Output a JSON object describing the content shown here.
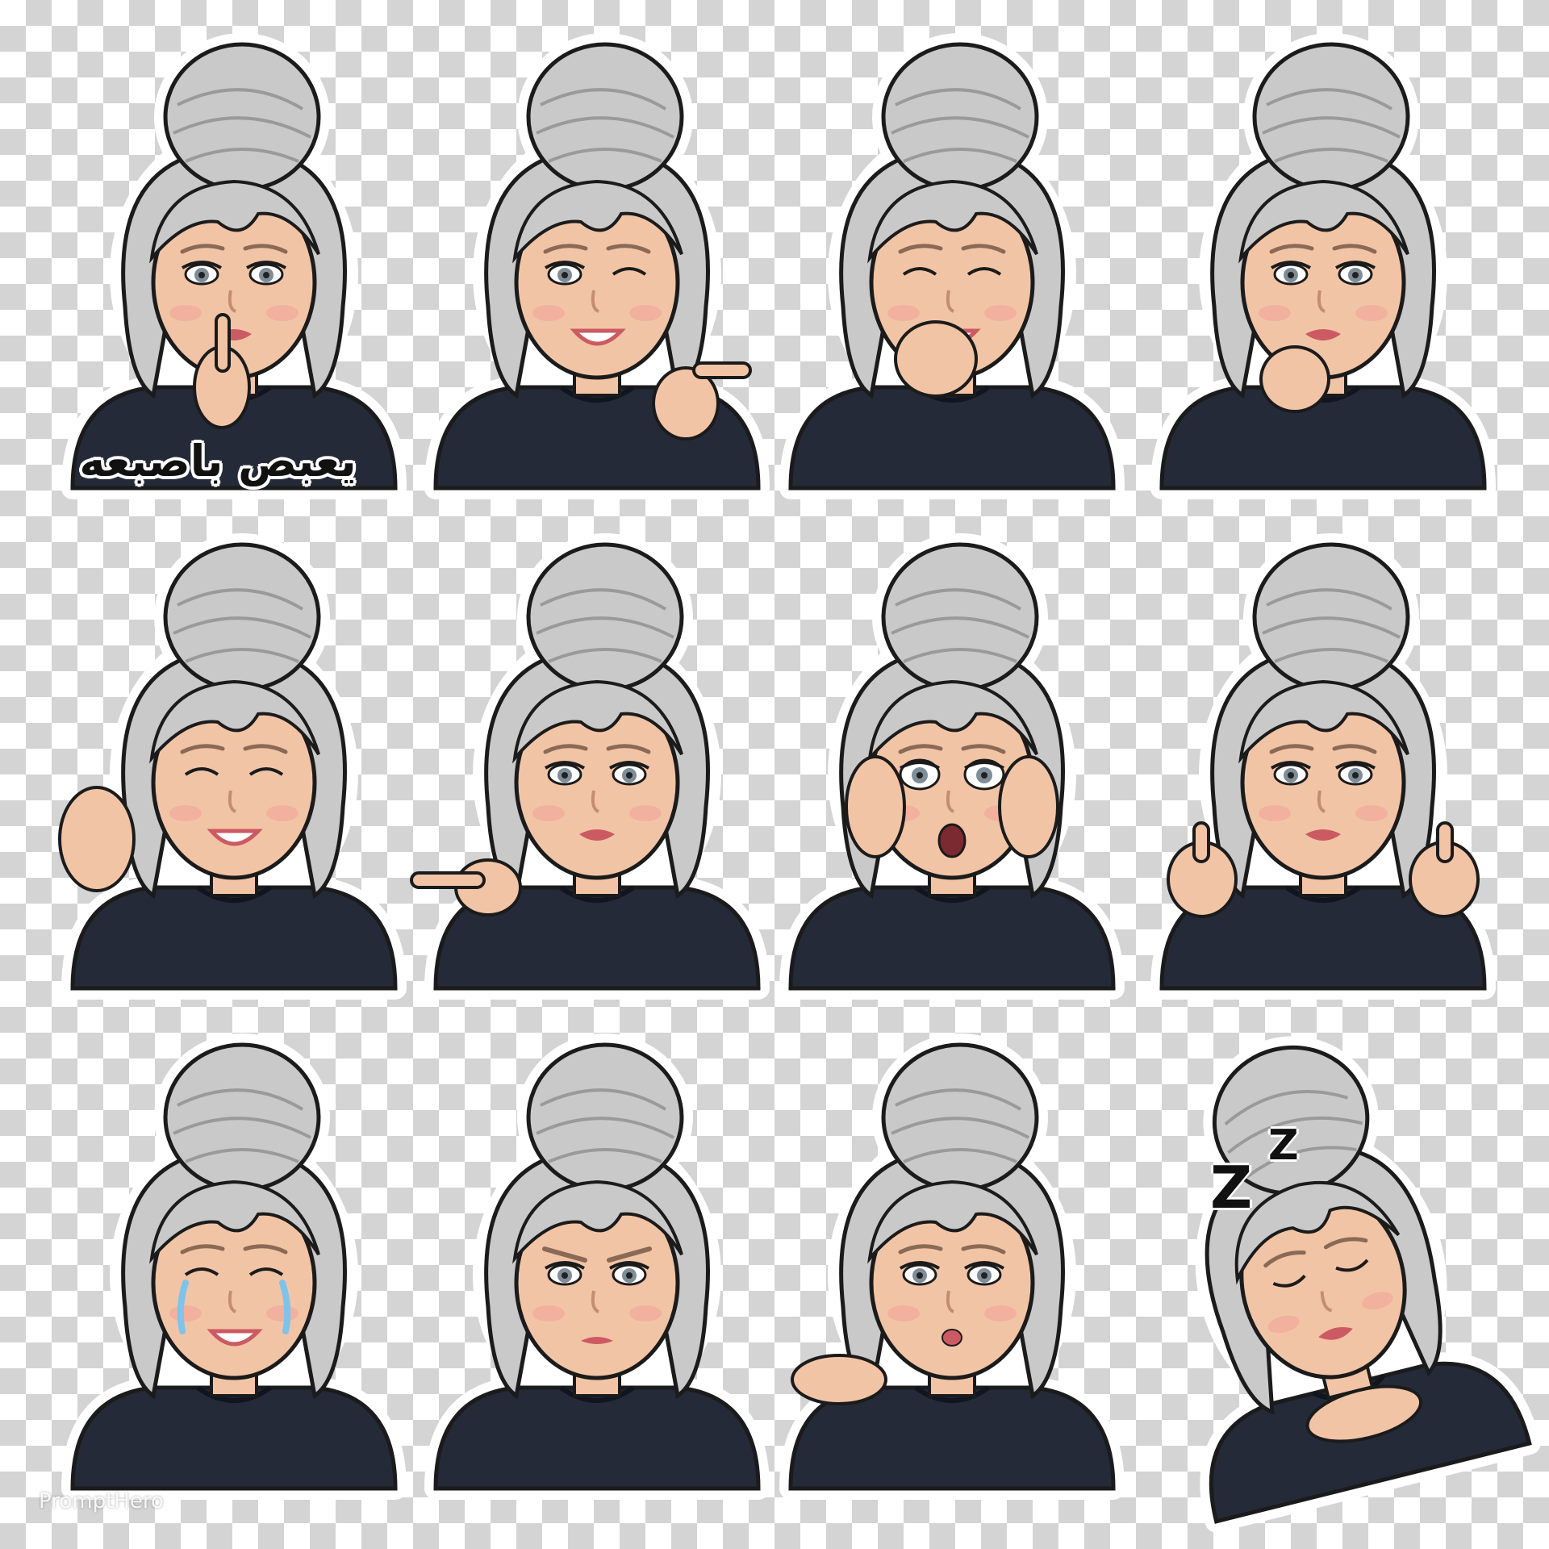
{
  "sticker_sheet": {
    "caption": "يعبص باصبعه",
    "sleep_letters": [
      "Z",
      "Z"
    ],
    "watermark": "PromptHero",
    "colors": {
      "checker_dark": "#d4d4d4",
      "checker_light": "#ffffff",
      "hair": "#c9c9c9",
      "skin": "#f2c4a6",
      "sweater": "#242a38",
      "outline": "#1b1b1b",
      "sticker_border": "#ffffff",
      "lips": "#cc5a62",
      "tears": "#7ec3ea"
    },
    "stickers": [
      {
        "expression": "shush",
        "gesture": "finger-on-lips"
      },
      {
        "expression": "wink-grin",
        "gesture": "finger-gun"
      },
      {
        "expression": "giggle",
        "gesture": "hand-over-mouth"
      },
      {
        "expression": "thinking",
        "gesture": "hand-on-chin"
      },
      {
        "expression": "laughing",
        "gesture": "wave"
      },
      {
        "expression": "smirk",
        "gesture": "pointing"
      },
      {
        "expression": "shocked",
        "gesture": "hands-on-cheeks"
      },
      {
        "expression": "smile",
        "gesture": "thumbs-up"
      },
      {
        "expression": "crying-laughing",
        "gesture": "none"
      },
      {
        "expression": "angry",
        "gesture": "none"
      },
      {
        "expression": "blowing-kiss",
        "gesture": "open-palm"
      },
      {
        "expression": "sleeping",
        "gesture": "head-on-hands"
      }
    ]
  }
}
